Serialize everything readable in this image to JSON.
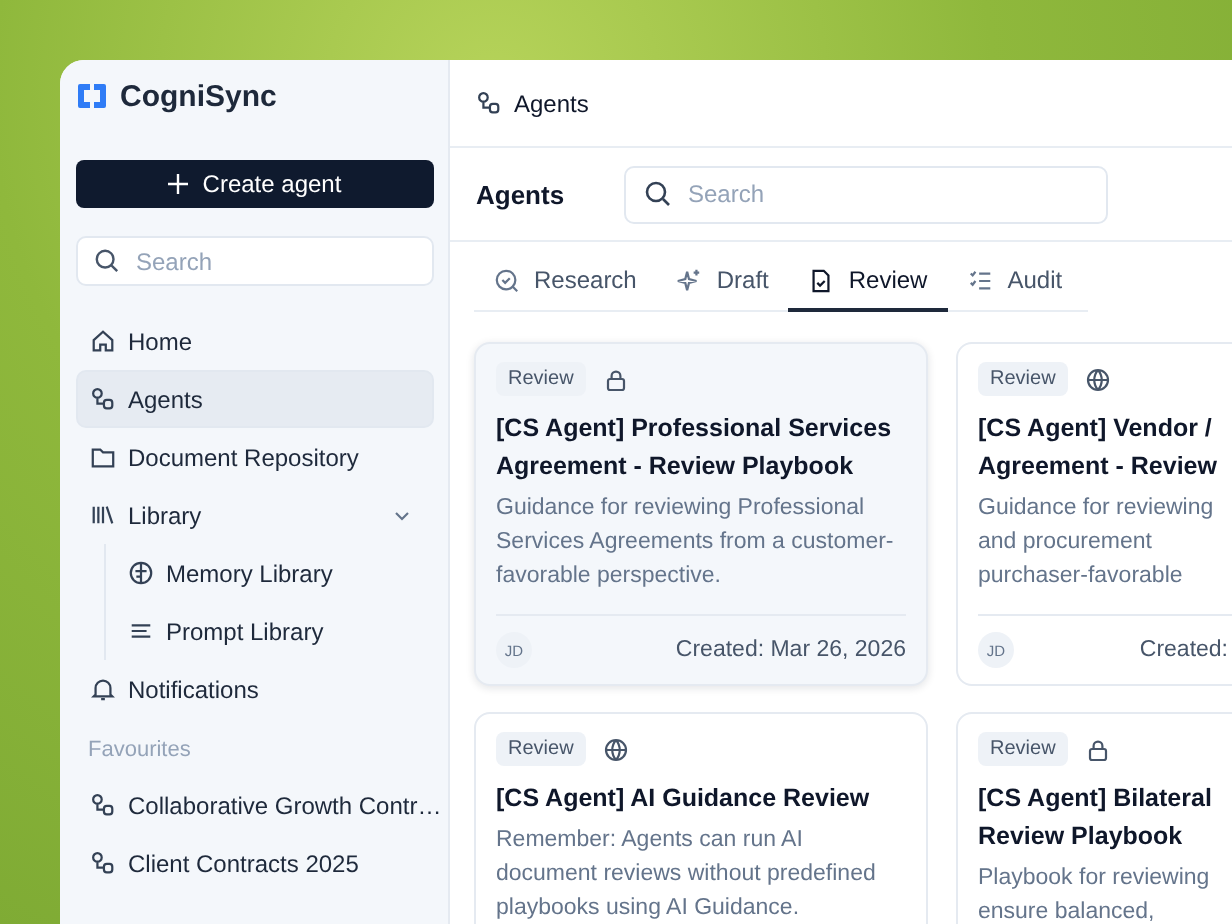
{
  "brand": {
    "name": "CogniSync"
  },
  "sidebar": {
    "create_button": "Create agent",
    "search": {
      "placeholder": "Search"
    },
    "items": [
      {
        "label": "Home",
        "selected": false
      },
      {
        "label": "Agents",
        "selected": true
      },
      {
        "label": "Document Repository",
        "selected": false
      },
      {
        "label": "Library",
        "selected": false,
        "expanded": true,
        "children": [
          {
            "label": "Memory Library",
            "selected": false
          },
          {
            "label": "Prompt Library",
            "selected": false
          }
        ]
      },
      {
        "label": "Notifications",
        "selected": false
      }
    ],
    "favourites_heading": "Favourites",
    "favourites": [
      {
        "label": "Collaborative Growth Contr…"
      },
      {
        "label": "Client Contracts 2025"
      }
    ]
  },
  "breadcrumb": "Agents",
  "header": {
    "title": "Agents",
    "search": {
      "placeholder": "Search"
    }
  },
  "tabs": [
    {
      "label": "Research",
      "selected": false
    },
    {
      "label": "Draft",
      "selected": false
    },
    {
      "label": "Review",
      "selected": true
    },
    {
      "label": "Audit",
      "selected": false
    }
  ],
  "cards": [
    {
      "tag": "Review",
      "locked": true,
      "highlighted": true,
      "title_lines": [
        "[CS Agent] Professional Services",
        "Agreement - Review Playbook"
      ],
      "description_lines": [
        "Guidance for reviewing Professional",
        "Services Agreements from a customer-",
        "favorable perspective."
      ],
      "avatar": "JD",
      "created": "Created: Mar 26, 2026"
    },
    {
      "tag": "Review",
      "locked": false,
      "highlighted": false,
      "title_lines": [
        "[CS Agent] Vendor /",
        "Agreement - Review"
      ],
      "description_lines": [
        "Guidance for reviewing",
        "and procurement",
        "purchaser-favorable"
      ],
      "avatar": "JD",
      "created": "Created:"
    },
    {
      "tag": "Review",
      "locked": false,
      "highlighted": false,
      "title_lines": [
        "[CS Agent] AI Guidance Review"
      ],
      "description_lines": [
        "Remember: Agents can run AI",
        "document reviews without predefined",
        "playbooks using AI Guidance."
      ]
    },
    {
      "tag": "Review",
      "locked": true,
      "highlighted": false,
      "title_lines": [
        "[CS Agent] Bilateral",
        "Review Playbook"
      ],
      "description_lines": [
        "Playbook for reviewing",
        "ensure balanced,"
      ]
    }
  ]
}
